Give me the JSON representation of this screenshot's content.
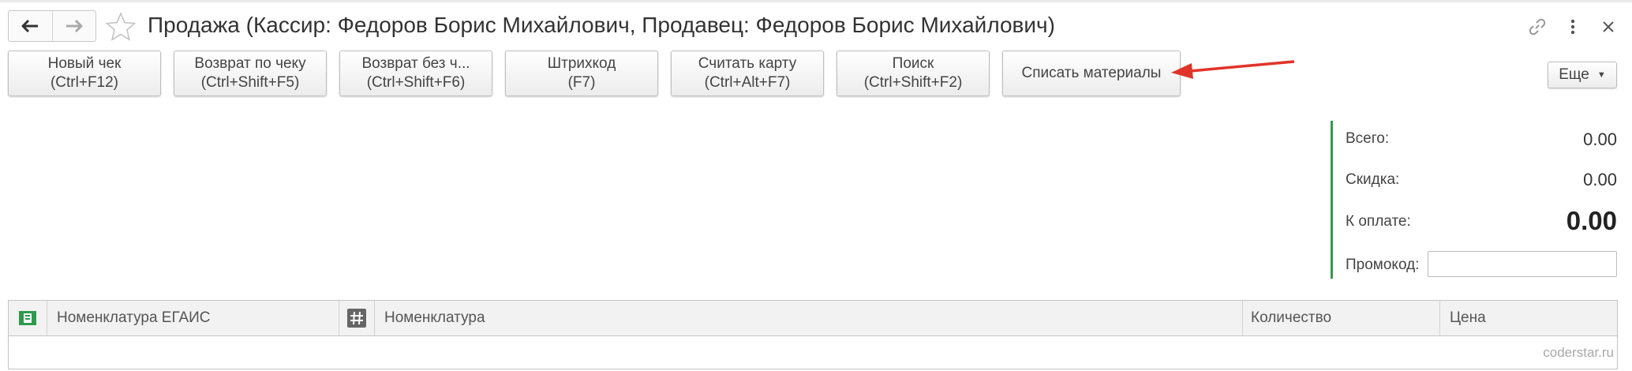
{
  "window": {
    "title": "Продажа (Кассир: Федоров Борис Михайлович, Продавец: Федоров Борис Михайлович)"
  },
  "toolbar": {
    "buttons": [
      {
        "line1": "Новый чек",
        "line2": "(Ctrl+F12)"
      },
      {
        "line1": "Возврат по чеку",
        "line2": "(Ctrl+Shift+F5)"
      },
      {
        "line1": "Возврат без ч...",
        "line2": "(Ctrl+Shift+F6)"
      },
      {
        "line1": "Штрихкод",
        "line2": "(F7)"
      },
      {
        "line1": "Считать карту",
        "line2": "(Ctrl+Alt+F7)"
      },
      {
        "line1": "Поиск",
        "line2": "(Ctrl+Shift+F2)"
      },
      {
        "line1": "Списать материалы",
        "line2": ""
      }
    ],
    "more_label": "Еще"
  },
  "totals": {
    "total_label": "Всего:",
    "total_value": "0.00",
    "discount_label": "Скидка:",
    "discount_value": "0.00",
    "to_pay_label": "К оплате:",
    "to_pay_value": "0.00",
    "promo_label": "Промокод:",
    "promo_value": ""
  },
  "table": {
    "columns": [
      "Номенклатура ЕГАИС",
      "Номенклатура",
      "Количество",
      "Цена"
    ]
  },
  "watermark": "coderstar.ru",
  "colors": {
    "accent_green": "#2e9a4e",
    "annotation_arrow": "#e0342a"
  },
  "icons": [
    "back-arrow-icon",
    "forward-arrow-icon",
    "favorite-star-icon",
    "link-icon",
    "more-vertical-icon",
    "close-icon",
    "egais-icon",
    "hash-icon"
  ]
}
